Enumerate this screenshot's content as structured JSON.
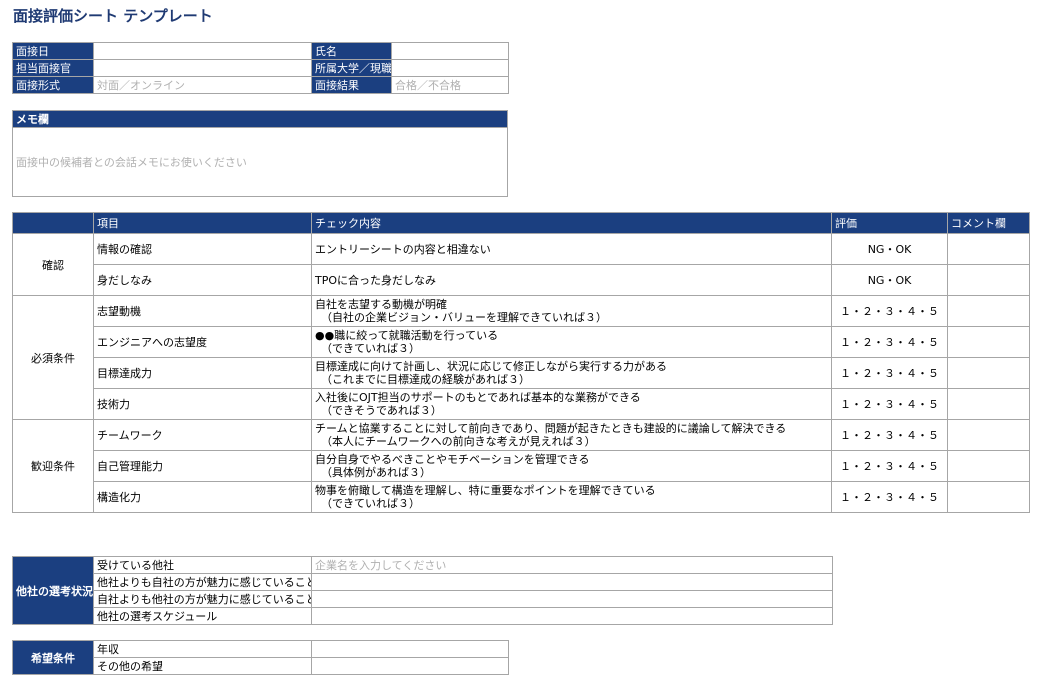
{
  "title": "面接評価シート テンプレート",
  "info": {
    "interview_date_label": "面接日",
    "name_label": "氏名",
    "interviewer_label": "担当面接官",
    "affiliation_label": "所属大学／現職",
    "format_label": "面接形式",
    "format_placeholder": "対面／オンライン",
    "result_label": "面接結果",
    "result_placeholder": "合格／不合格"
  },
  "memo": {
    "label": "メモ欄",
    "placeholder": "面接中の候補者との会話メモにお使いください"
  },
  "evaluation": {
    "headers": {
      "item": "項目",
      "check": "チェック内容",
      "rating": "評価",
      "comment": "コメント欄"
    },
    "groups": [
      {
        "name": "確認",
        "rows": [
          {
            "item": "情報の確認",
            "check": "エントリーシートの内容と相違ない",
            "check_sub": "",
            "rating": "NG・OK"
          },
          {
            "item": "身だしなみ",
            "check": "TPOに合った身だしなみ",
            "check_sub": "",
            "rating": "NG・OK"
          }
        ]
      },
      {
        "name": "必須条件",
        "rows": [
          {
            "item": "志望動機",
            "check": "自社を志望する動機が明確",
            "check_sub": "（自社の企業ビジョン・バリューを理解できていれば３）",
            "rating": "１・２・３・４・５"
          },
          {
            "item": "エンジニアへの志望度",
            "check": "●●職に絞って就職活動を行っている",
            "check_sub": "（できていれば３）",
            "rating": "１・２・３・４・５"
          },
          {
            "item": "目標達成力",
            "check": "目標達成に向けて計画し、状況に応じて修正しながら実行する力がある",
            "check_sub": "（これまでに目標達成の経験があれば３）",
            "rating": "１・２・３・４・５"
          },
          {
            "item": "技術力",
            "check": "入社後にOJT担当のサポートのもとであれば基本的な業務ができる",
            "check_sub": "（できそうであれば３）",
            "rating": "１・２・３・４・５"
          }
        ]
      },
      {
        "name": "歓迎条件",
        "rows": [
          {
            "item": "チームワーク",
            "check": "チームと協業することに対して前向きであり、問題が起きたときも建設的に議論して解決できる",
            "check_sub": "（本人にチームワークへの前向きな考えが見えれば３）",
            "rating": "１・２・３・４・５"
          },
          {
            "item": "自己管理能力",
            "check": "自分自身でやるべきことやモチベーションを管理できる",
            "check_sub": "（具体例があれば３）",
            "rating": "１・２・３・４・５"
          },
          {
            "item": "構造化力",
            "check": "物事を俯瞰して構造を理解し、特に重要なポイントを理解できている",
            "check_sub": "（できていれば３）",
            "rating": "１・２・３・４・５"
          }
        ]
      }
    ]
  },
  "other_companies": {
    "label": "他社の選考状況",
    "rows": [
      {
        "label": "受けている他社",
        "placeholder": "企業名を入力してください"
      },
      {
        "label": "他社よりも自社の方が魅力に感じていること",
        "placeholder": ""
      },
      {
        "label": "自社よりも他社の方が魅力に感じていること",
        "placeholder": ""
      },
      {
        "label": "他社の選考スケジュール",
        "placeholder": ""
      }
    ]
  },
  "wishes": {
    "label": "希望条件",
    "rows": [
      {
        "label": "年収"
      },
      {
        "label": "その他の希望"
      }
    ]
  },
  "colors": {
    "header_bg": "#1b3f80",
    "title": "#1f3a73",
    "border": "#a6a6a6",
    "placeholder": "#b0b0b0"
  }
}
